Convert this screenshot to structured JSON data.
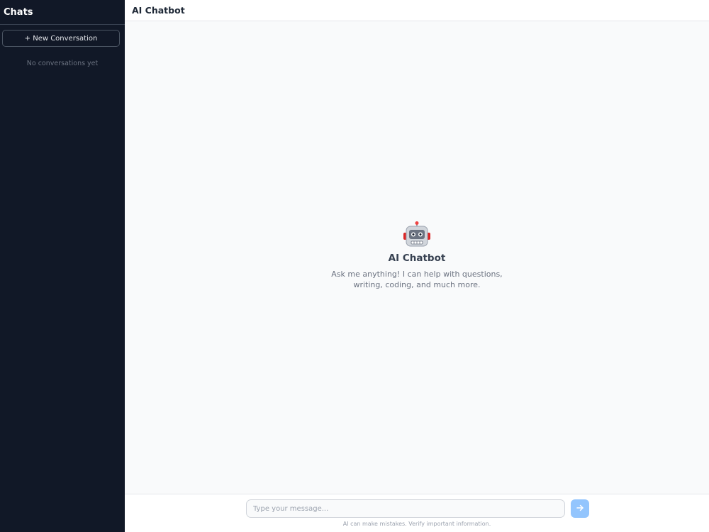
{
  "sidebar": {
    "title": "Chats",
    "new_conversation_label": "+ New Conversation",
    "empty_text": "No conversations yet"
  },
  "header": {
    "title": "AI Chatbot"
  },
  "welcome": {
    "icon": "robot-icon",
    "title": "AI Chatbot",
    "text": "Ask me anything! I can help with questions, writing, coding, and much more."
  },
  "composer": {
    "placeholder": "Type your message...",
    "value": "",
    "send_icon": "arrow-right-icon",
    "disclaimer": "AI can make mistakes. Verify important information."
  },
  "colors": {
    "sidebar_bg": "#111827",
    "accent_send": "#93c5fd",
    "main_bg": "#f9fafb"
  }
}
